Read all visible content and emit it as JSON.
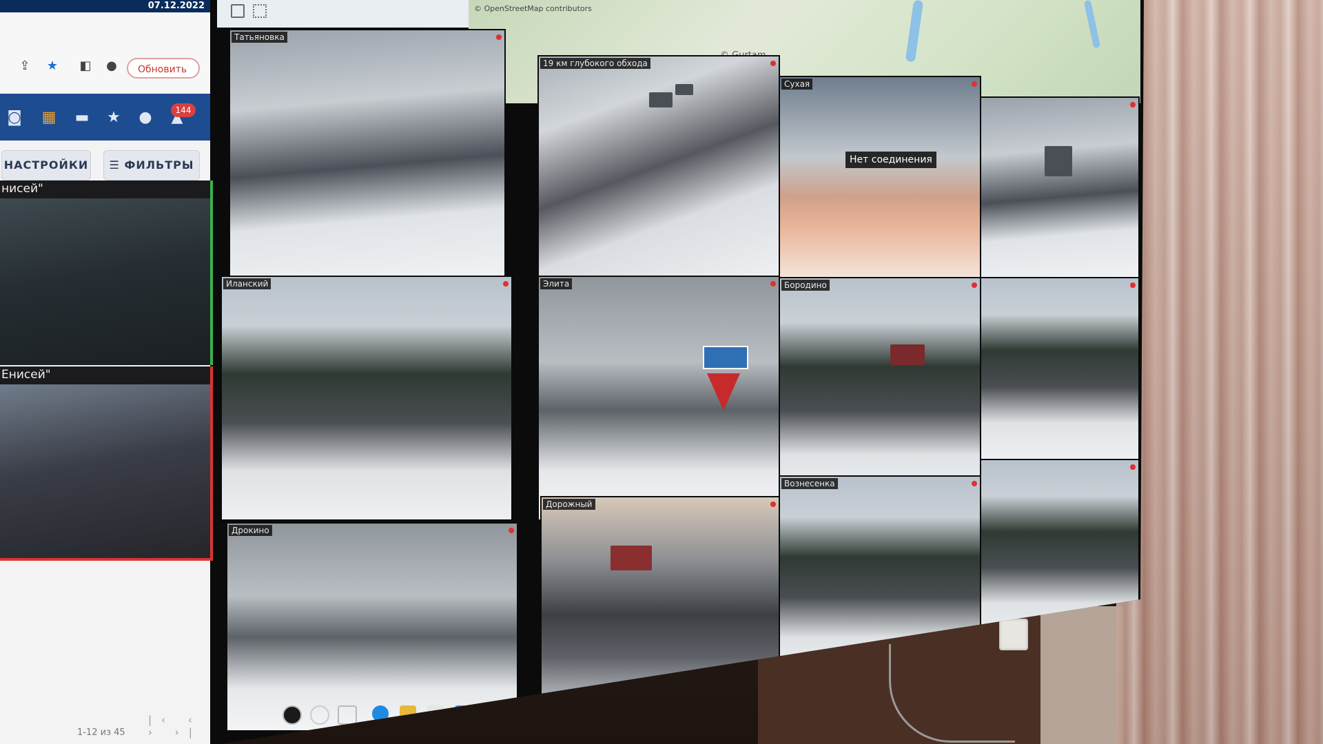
{
  "left_panel": {
    "date": "07.12.2022",
    "update_button": "Обновить",
    "notification_count": "144",
    "settings_button": "НАСТРОЙКИ",
    "filters_button": "ФИЛЬТРЫ",
    "side_cameras": [
      {
        "label": "нисей\""
      },
      {
        "label": "Енисей\""
      }
    ],
    "pager": "1-12 из 45",
    "icons": [
      "share-icon",
      "star-icon",
      "sidebar-icon",
      "profile-icon",
      "camera-icon",
      "grid-icon",
      "truck-icon",
      "star-icon",
      "user-icon",
      "bell-icon"
    ]
  },
  "map": {
    "attribution": "© OpenStreetMap contributors",
    "credit": "© Gurtam"
  },
  "cameras": [
    {
      "label": "Татьяновка"
    },
    {
      "label": "19 км глубокого обхода"
    },
    {
      "label": "Сухая"
    },
    {
      "label": "Иланский"
    },
    {
      "label": "Элита"
    },
    {
      "label": "Бородино"
    },
    {
      "label": "Дрокино"
    },
    {
      "label": "Дорожный"
    },
    {
      "label": "Вознесенка"
    }
  ],
  "no_connection_text": "Нет соединения",
  "colors": {
    "nav_blue": "#1d4c91",
    "date_bar": "#0a2c5c",
    "active_green": "#3bb34a",
    "alert_red": "#d33333",
    "badge_red": "#d94040"
  }
}
